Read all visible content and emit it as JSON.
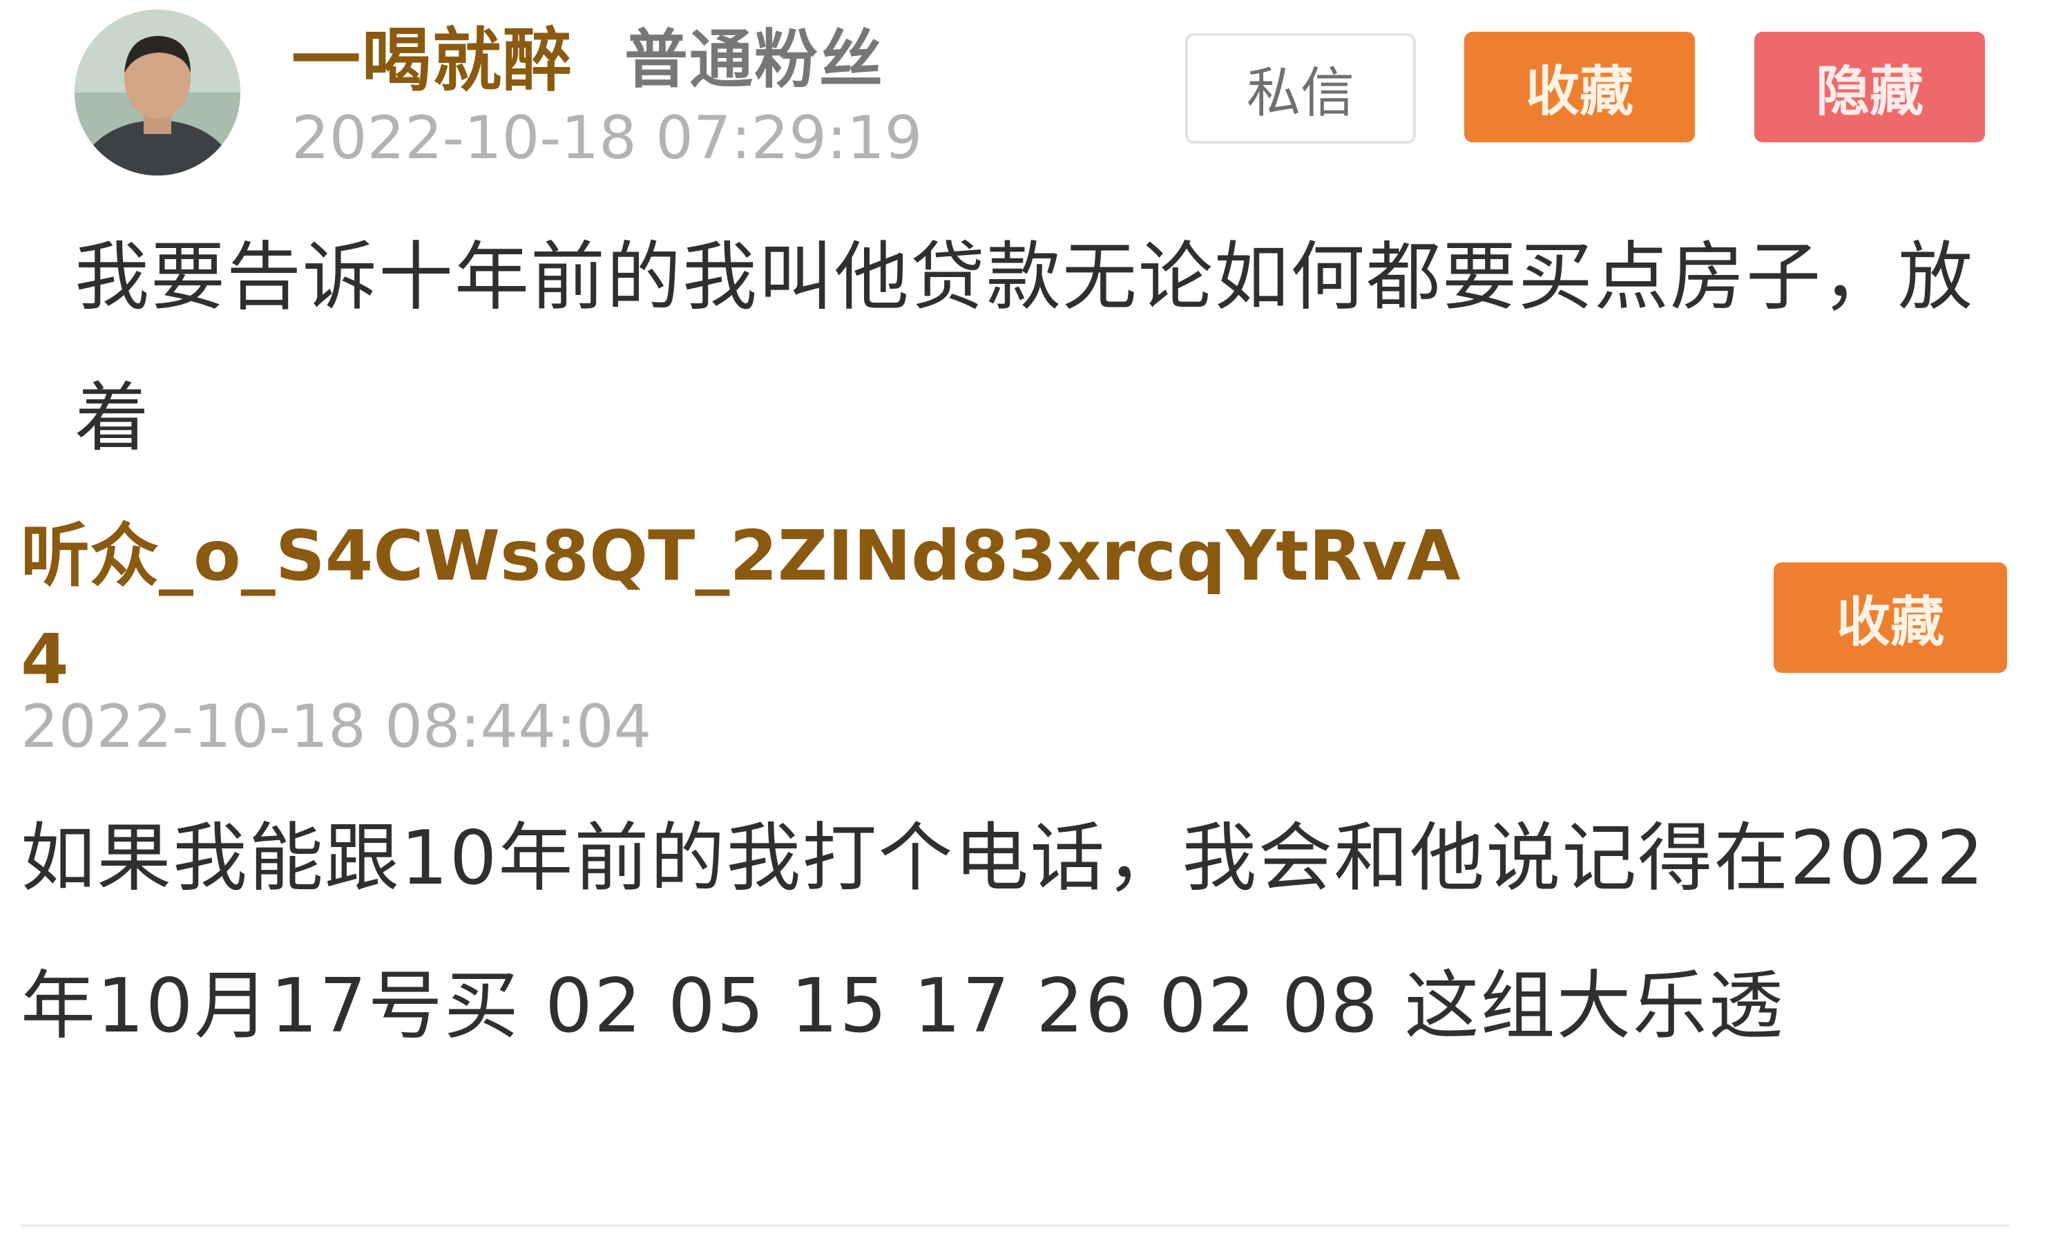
{
  "comments": [
    {
      "username": "一喝就醉",
      "badge": "普通粉丝",
      "timestamp": "2022-10-18 07:29:19",
      "buttons": {
        "message": "私信",
        "favorite": "收藏",
        "hide": "隐藏"
      },
      "content": "我要告诉十年前的我叫他贷款无论如何都要买点房子，放着"
    },
    {
      "username": "听众_o_S4CWs8QT_2ZINd83xrcqYtRvA4",
      "timestamp": "2022-10-18 08:44:04",
      "buttons": {
        "favorite": "收藏"
      },
      "content": "如果我能跟10年前的我打个电话，我会和他说记得在2022年10月17号买 02 05 15 17 26 02 08 这组大乐透"
    }
  ],
  "colors": {
    "username": "#8a5a10",
    "favorite_button": "#ee7f31",
    "hide_button": "#ee6a6a",
    "timestamp": "#b3b3b3"
  }
}
